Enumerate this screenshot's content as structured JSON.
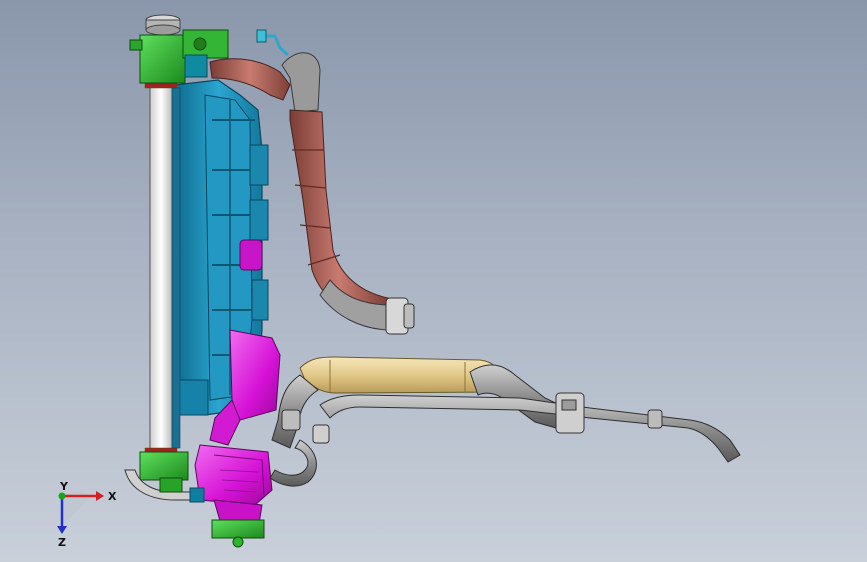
{
  "viewport": {
    "background_top": "#8a97ab",
    "background_bottom": "#c9d0da"
  },
  "triad": {
    "x_label": "X",
    "y_label": "Y",
    "z_label": "Z",
    "x_color": "#d42020",
    "y_color": "#19a319",
    "z_color": "#2030c8"
  },
  "parts": {
    "radiator_core": "#ffffff",
    "shroud": "#1e8fb8",
    "upper_hose": "#b9685c",
    "intake_pipe": "#e8d49a",
    "metal_pipe": "#8c8c8c",
    "expansion_tank": "#e51ee5",
    "fittings": "#2bb52b"
  }
}
